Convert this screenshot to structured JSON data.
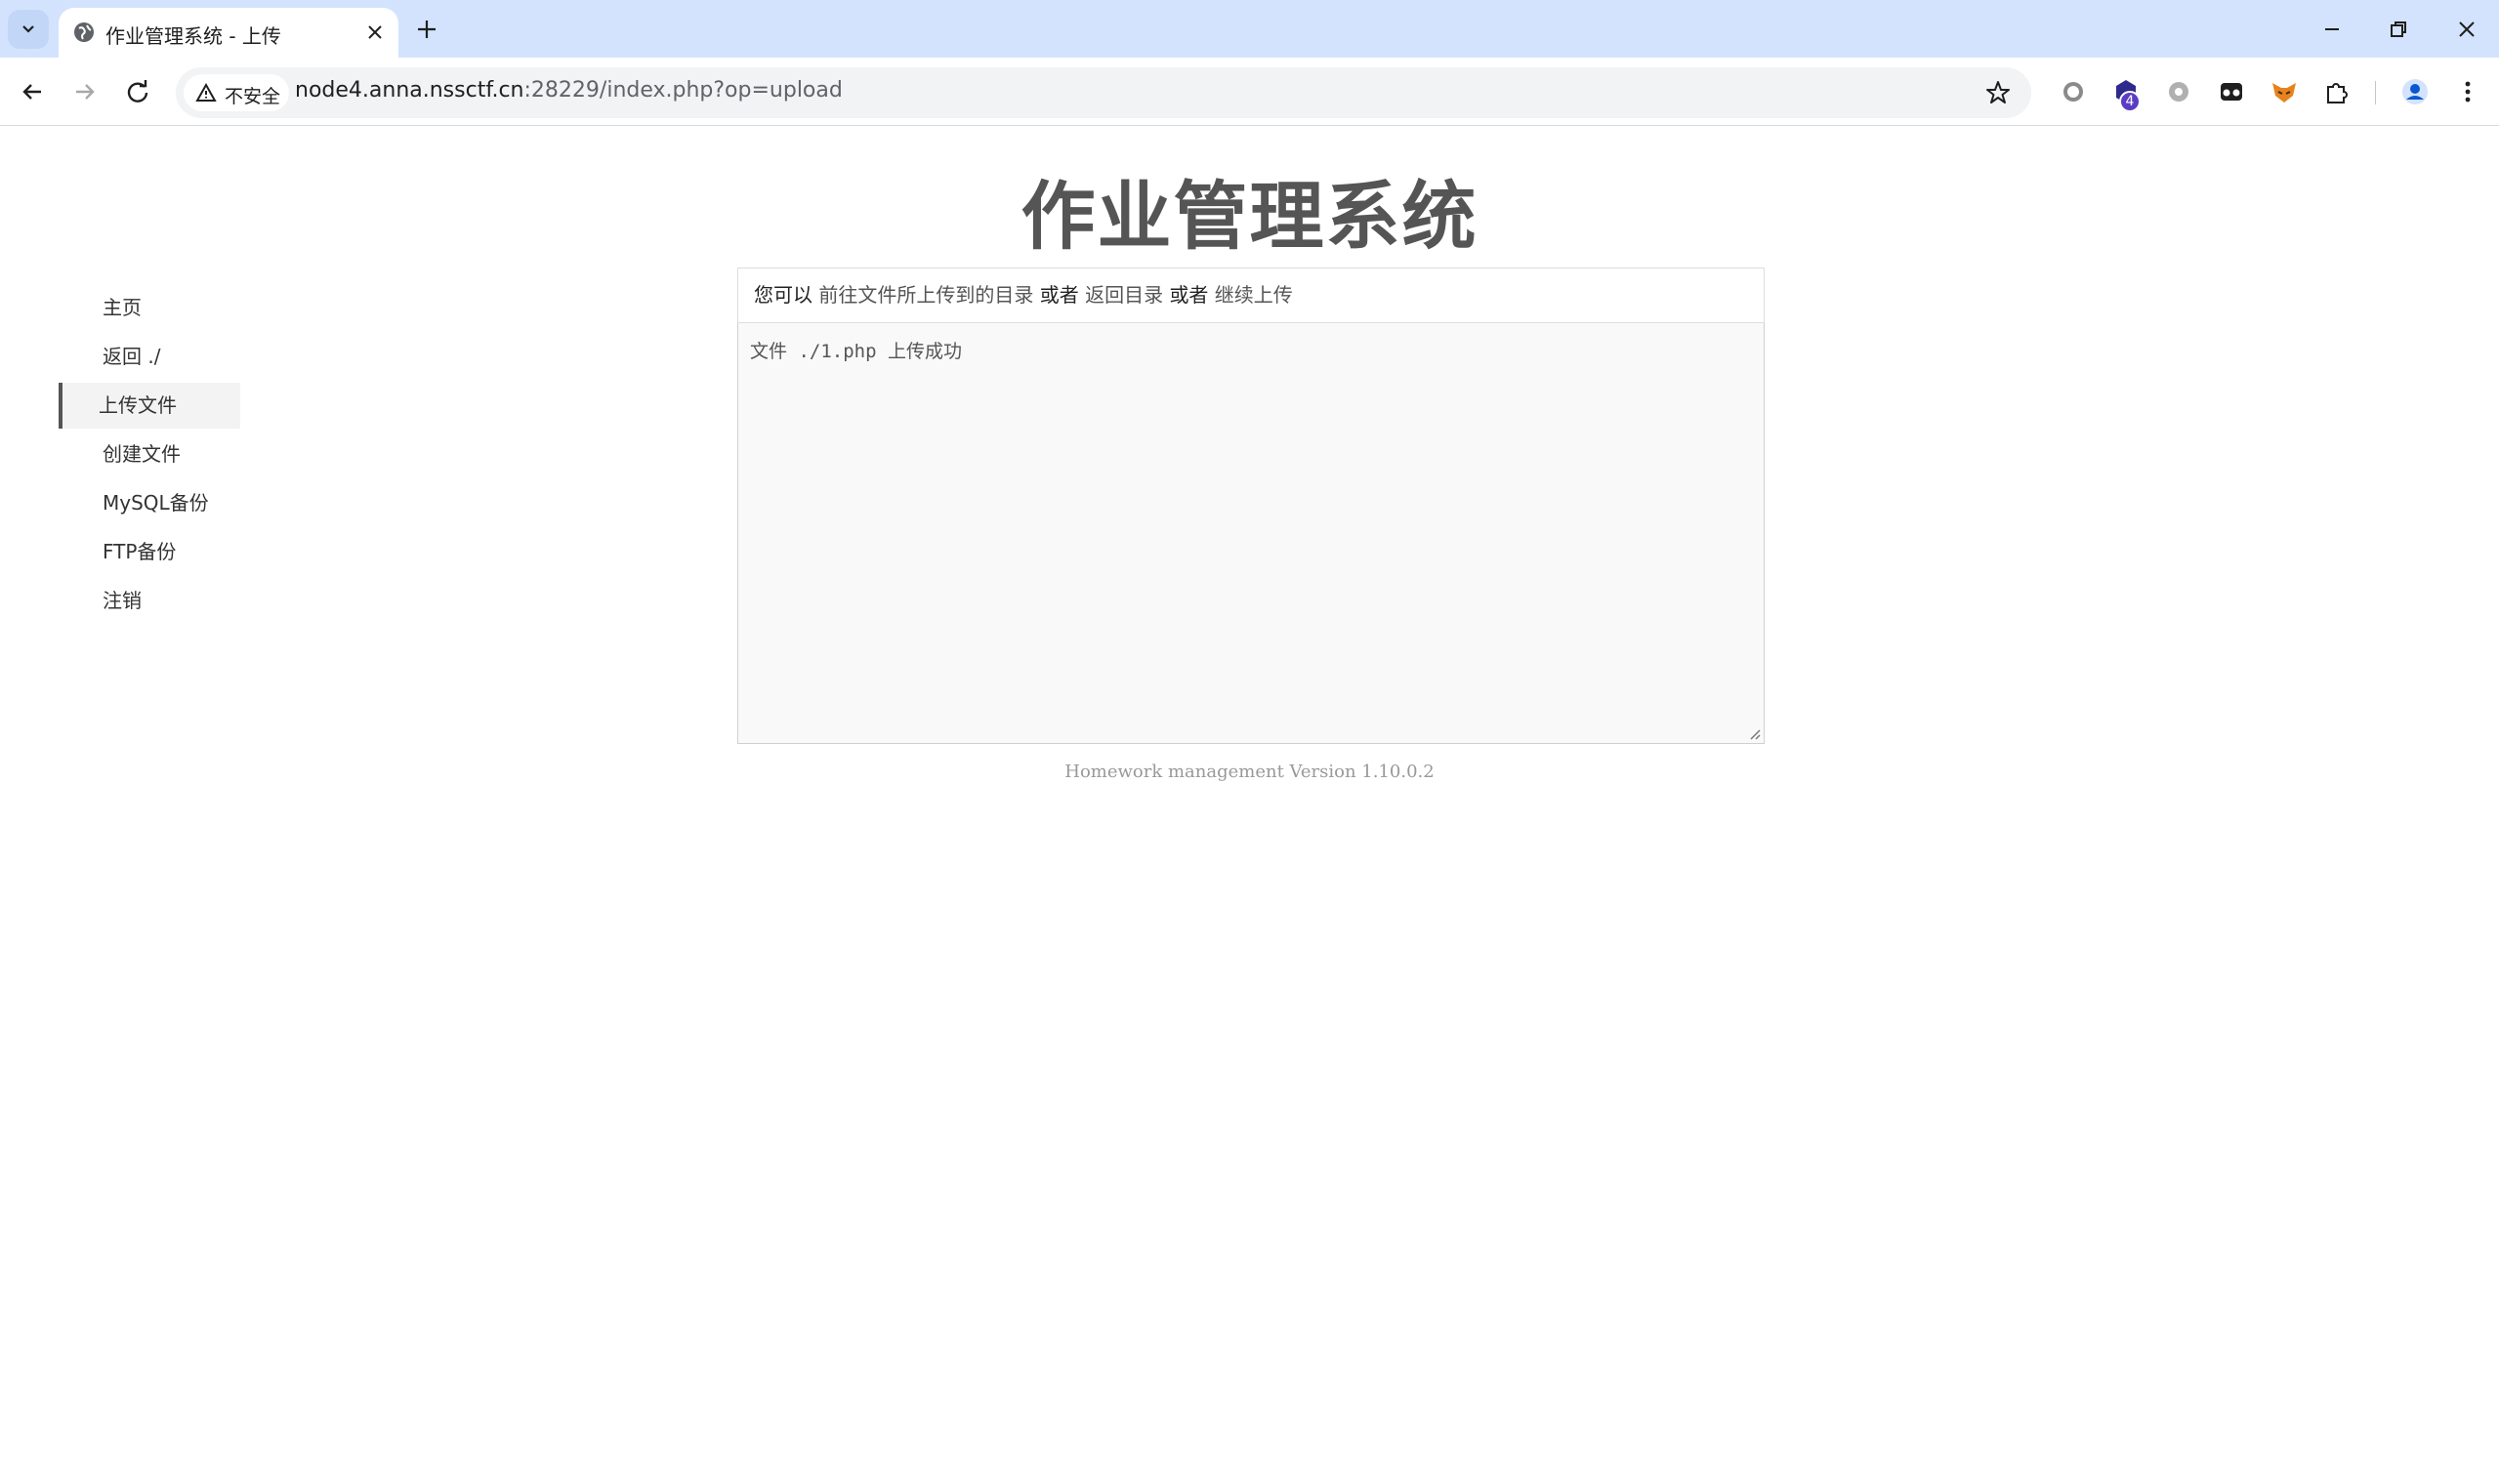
{
  "browser": {
    "tab_title": "作业管理系统 - 上传",
    "security_label": "不安全",
    "url_host": "node4.anna.nssctf.cn",
    "url_rest": ":28229/index.php?op=upload",
    "extension_badge": "4"
  },
  "page": {
    "title": "作业管理系统",
    "sidebar": [
      {
        "label": "主页",
        "active": false
      },
      {
        "label": "返回 ./",
        "active": false
      },
      {
        "label": "上传文件",
        "active": true
      },
      {
        "label": "创建文件",
        "active": false
      },
      {
        "label": "MySQL备份",
        "active": false
      },
      {
        "label": "FTP备份",
        "active": false
      },
      {
        "label": "注销",
        "active": false
      }
    ],
    "info": {
      "prefix": "您可以",
      "link1": "前往文件所上传到的目录",
      "or1": "或者",
      "link2": "返回目录",
      "or2": "或者",
      "link3": "继续上传"
    },
    "result_text": "文件 ./1.php 上传成功",
    "footer": "Homework management Version 1.10.0.2"
  }
}
